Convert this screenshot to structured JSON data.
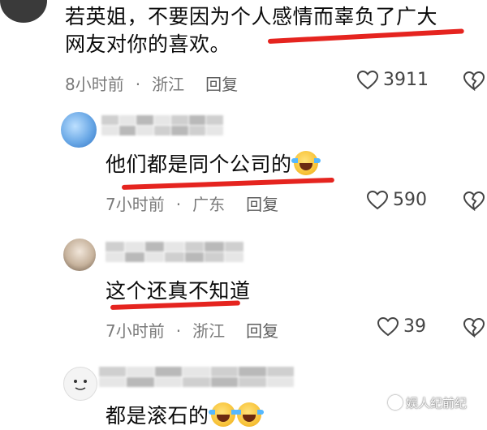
{
  "comments": [
    {
      "text_line1": "若英姐，不要因为个人感情而辜负了广大",
      "text_line2": "网友对你的喜欢。",
      "time": "8小时前",
      "location": "浙江",
      "reply_label": "回复",
      "likes": "3911"
    },
    {
      "text": "他们都是同个公司的",
      "emoji": "rolling-laughing-emoji",
      "time": "7小时前",
      "location": "广东",
      "reply_label": "回复",
      "likes": "590"
    },
    {
      "text": "这个还真不知道",
      "time": "7小时前",
      "location": "浙江",
      "reply_label": "回复",
      "likes": "39"
    },
    {
      "text": "都是滚石的",
      "emoji": "crying-laughing-emoji"
    }
  ],
  "meta_separator": "·",
  "watermark": "娱人纪前纪",
  "accent": "#e5241f"
}
